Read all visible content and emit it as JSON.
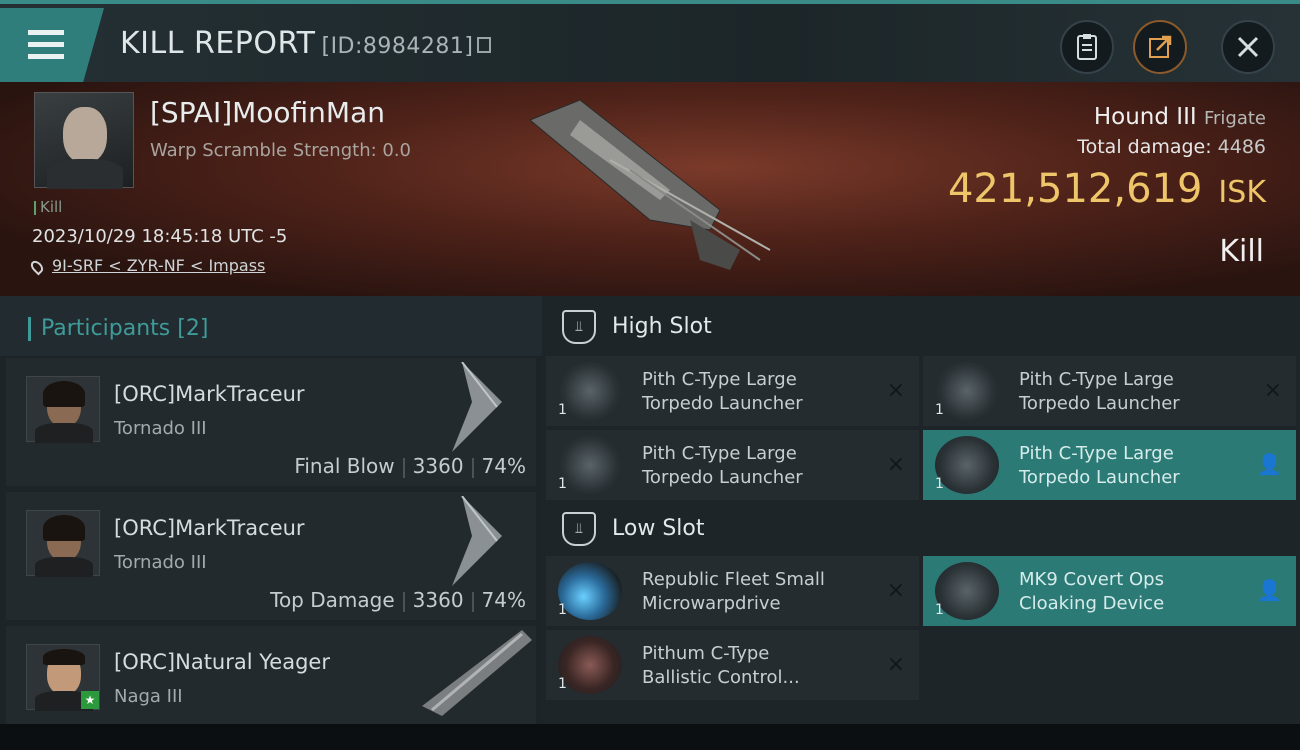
{
  "header": {
    "title": "KILL REPORT",
    "report_id": "[ID:8984281]",
    "icons": [
      "menu-icon",
      "clipboard-icon",
      "share-icon",
      "close-icon"
    ]
  },
  "victim": {
    "name": "[SPAI]MoofinMan",
    "scramble": "Warp Scramble Strength: 0.0",
    "tag": "Kill",
    "datetime": "2023/10/29 18:45:18 UTC -5",
    "location": "9I-SRF < ZYR-NF < Impass",
    "ship": "Hound III",
    "ship_class": "Frigate",
    "total_damage_label": "Total damage:",
    "total_damage": "4486",
    "isk_value": "421,512,619",
    "isk_unit": "ISK",
    "result": "Kill"
  },
  "participants": {
    "title": "Participants",
    "count": "[2]",
    "items": [
      {
        "name": "[ORC]MarkTraceur",
        "ship": "Tornado III",
        "role": "Final Blow",
        "damage": "3360",
        "percent": "74%"
      },
      {
        "name": "[ORC]MarkTraceur",
        "ship": "Tornado III",
        "role": "Top Damage",
        "damage": "3360",
        "percent": "74%"
      },
      {
        "name": "[ORC]Natural Yeager",
        "ship": "Naga III",
        "role": "",
        "damage": "",
        "percent": ""
      }
    ]
  },
  "slots": {
    "high": {
      "label": "High Slot",
      "modules": [
        {
          "line1": "Pith C-Type Large",
          "line2": "Torpedo Launcher",
          "qty": "1",
          "action": "×"
        },
        {
          "line1": "Pith C-Type Large",
          "line2": "Torpedo Launcher",
          "qty": "1",
          "action": "×"
        },
        {
          "line1": "Pith C-Type Large",
          "line2": "Torpedo Launcher",
          "qty": "1",
          "action": "×"
        },
        {
          "line1": "Pith C-Type Large",
          "line2": "Torpedo Launcher",
          "qty": "1",
          "action": "👤"
        }
      ]
    },
    "low": {
      "label": "Low Slot",
      "modules": [
        {
          "line1": "Republic Fleet Small",
          "line2": "Microwarpdrive",
          "qty": "1",
          "action": "×"
        },
        {
          "line1": "MK9 Covert Ops",
          "line2": "Cloaking Device",
          "qty": "1",
          "action": "👤"
        },
        {
          "line1": "Pithum C-Type",
          "line2": "Ballistic Control...",
          "qty": "1",
          "action": "×"
        }
      ]
    }
  }
}
